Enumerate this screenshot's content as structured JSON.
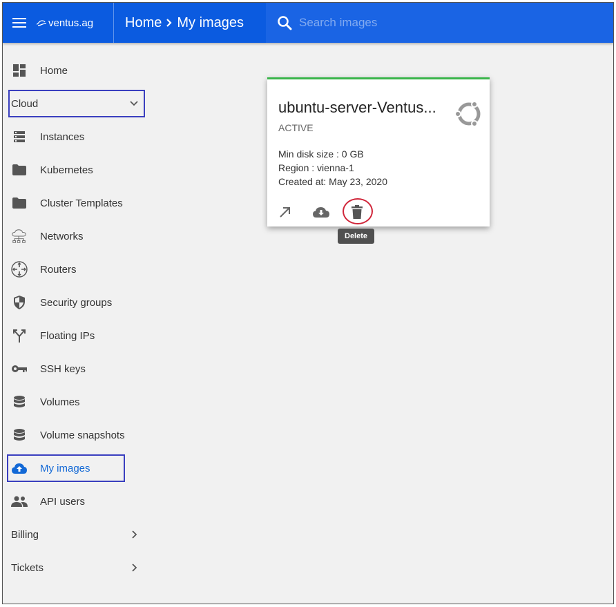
{
  "topbar": {
    "logo_text": "ventus.ag",
    "breadcrumb": [
      "Home",
      "My images"
    ],
    "search_placeholder": "Search images"
  },
  "sidebar": {
    "home": "Home",
    "cloud_section": "Cloud",
    "items": [
      {
        "label": "Instances",
        "icon": "instances-icon"
      },
      {
        "label": "Kubernetes",
        "icon": "folder-icon"
      },
      {
        "label": "Cluster Templates",
        "icon": "folder-icon"
      },
      {
        "label": "Networks",
        "icon": "network-cloud-icon"
      },
      {
        "label": "Routers",
        "icon": "router-icon"
      },
      {
        "label": "Security groups",
        "icon": "shield-icon"
      },
      {
        "label": "Floating IPs",
        "icon": "fork-arrows-icon"
      },
      {
        "label": "SSH keys",
        "icon": "key-icon"
      },
      {
        "label": "Volumes",
        "icon": "database-icon"
      },
      {
        "label": "Volume snapshots",
        "icon": "database-icon"
      },
      {
        "label": "My images",
        "icon": "cloud-upload-icon"
      },
      {
        "label": "API users",
        "icon": "people-icon"
      }
    ],
    "billing": "Billing",
    "tickets": "Tickets"
  },
  "image_card": {
    "title": "ubuntu-server-Ventus...",
    "status": "ACTIVE",
    "min_disk": "Min disk size : 0 GB",
    "region": "Region : vienna-1",
    "created": "Created at:  May 23, 2020"
  },
  "tooltip": "Delete",
  "colors": {
    "brand_blue": "#0b5be0",
    "active_green": "#3ab54a",
    "highlight_outline": "#3a3fbf",
    "delete_ring": "#d0263a"
  }
}
